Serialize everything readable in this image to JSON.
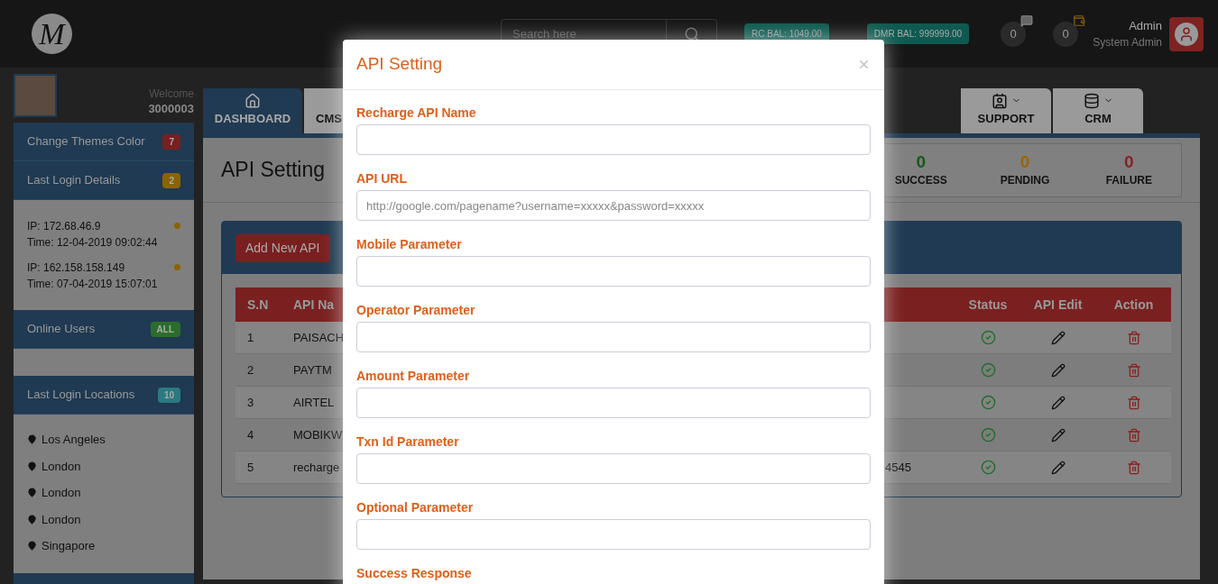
{
  "header": {
    "logo_letter": "M",
    "search": {
      "placeholder": "Search here"
    },
    "balances": [
      {
        "label": "RC BAL: 1049.00"
      },
      {
        "label": "DMR BAL: 999999.00"
      }
    ],
    "counters": [
      {
        "count": "0"
      },
      {
        "count": "0"
      }
    ],
    "user": {
      "name": "Admin",
      "role": "System Admin"
    }
  },
  "sidebar": {
    "welcome": "Welcome",
    "user_id": "3000003",
    "panels": [
      {
        "kind": "plain",
        "title": "Change Themes Color",
        "badge": "7",
        "color": "#7a1f1f"
      },
      {
        "kind": "logins",
        "title": "Last Login Details",
        "badge": "2",
        "color": "#8a6400",
        "entries": [
          {
            "ip": "IP: 172.68.46.9",
            "time": "Time: 12-04-2019 09:02:44"
          },
          {
            "ip": "IP: 162.158.158.149",
            "time": "Time: 07-04-2019 15:07:01"
          }
        ]
      },
      {
        "kind": "users",
        "title": "Online Users",
        "badge": "ALL",
        "color": "#2b6e2b"
      },
      {
        "kind": "locations",
        "title": "Last Login Locations",
        "badge": "10",
        "color": "#2b7a7f",
        "places": [
          "Los Angeles",
          "London",
          "London",
          "London",
          "Singapore"
        ]
      }
    ]
  },
  "tabs": [
    {
      "label": "DASHBOARD",
      "selected": true,
      "caret": false
    },
    {
      "label": "CMS",
      "selected": false,
      "caret": false
    },
    {
      "label": "SUPPORT",
      "selected": false,
      "caret": true
    },
    {
      "label": "CRM",
      "selected": false,
      "caret": true
    }
  ],
  "page": {
    "title": "API Setting",
    "stats": [
      {
        "value": "0",
        "label": "SUCCESS",
        "color": "#145a1c"
      },
      {
        "value": "0",
        "label": "PENDING",
        "color": "#9a6500"
      },
      {
        "value": "0",
        "label": "FAILURE",
        "color": "#8a2020"
      }
    ]
  },
  "api_card": {
    "add_button": "Add New API",
    "table": {
      "columns": [
        "S.N",
        "API Na",
        "Status",
        "API Edit",
        "Action"
      ],
      "rows": [
        {
          "sn": "1",
          "api_name": "PAISACH",
          "active": true
        },
        {
          "sn": "2",
          "api_name": "PAYTM",
          "active": true
        },
        {
          "sn": "3",
          "api_name": "AIRTEL",
          "active": true
        },
        {
          "sn": "4",
          "api_name": "MOBIKW",
          "active": true
        },
        {
          "sn": "5",
          "api_name": "recharge",
          "column_3": "4545",
          "active": true
        }
      ]
    }
  },
  "modal": {
    "title": "API Setting",
    "fields": [
      {
        "label": "Recharge API Name"
      },
      {
        "label": "API URL",
        "placeholder": "http://google.com/pagename?username=xxxxx&password=xxxxx"
      },
      {
        "label": "Mobile Parameter"
      },
      {
        "label": "Operator Parameter"
      },
      {
        "label": "Amount Parameter"
      },
      {
        "label": "Txn Id Parameter"
      },
      {
        "label": "Optional Parameter"
      },
      {
        "label": "Success Response"
      }
    ]
  }
}
